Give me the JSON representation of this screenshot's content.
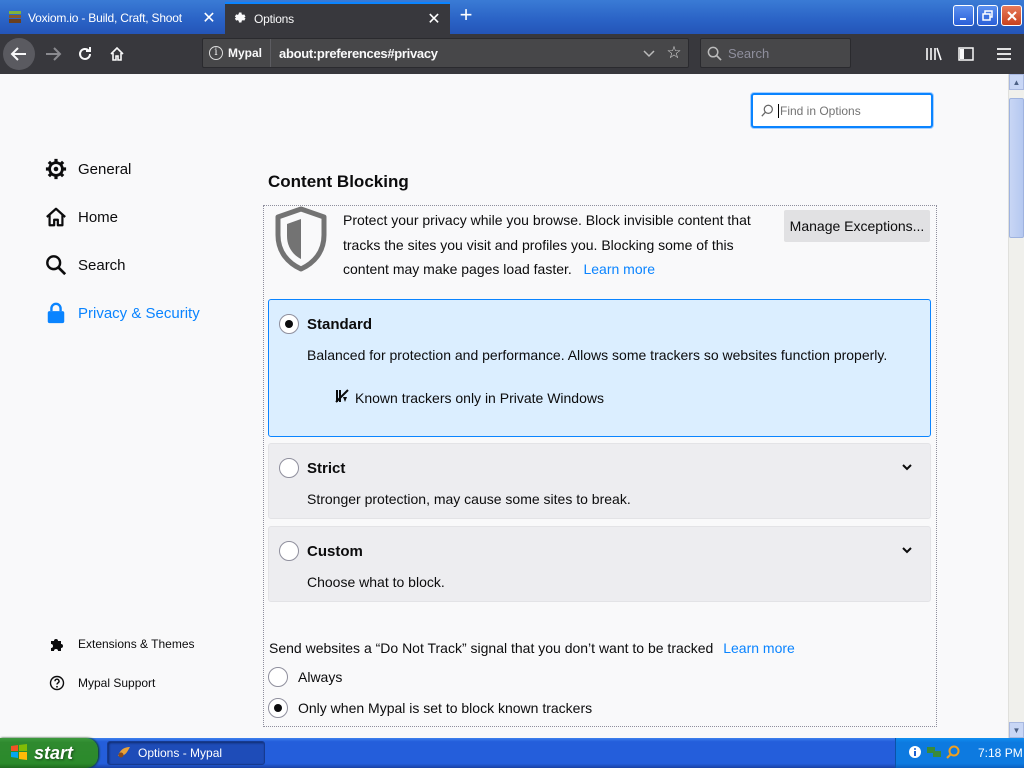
{
  "browser": {
    "tabs": [
      {
        "title": "Voxiom.io - Build, Craft, Shoot",
        "active": false
      },
      {
        "title": "Options",
        "active": true
      }
    ],
    "identity_label": "Mypal",
    "url": "about:preferences#privacy",
    "search_placeholder": "Search"
  },
  "prefs": {
    "find_placeholder": "Find in Options",
    "categories": [
      {
        "label": "General",
        "icon": "gear-icon"
      },
      {
        "label": "Home",
        "icon": "home-icon"
      },
      {
        "label": "Search",
        "icon": "search-icon"
      },
      {
        "label": "Privacy & Security",
        "icon": "lock-icon",
        "selected": true
      }
    ],
    "footer_links": [
      {
        "label": "Extensions & Themes",
        "icon": "puzzle-icon"
      },
      {
        "label": "Mypal Support",
        "icon": "help-icon"
      }
    ],
    "section_title": "Content Blocking",
    "description": "Protect your privacy while you browse. Block invisible content that tracks the sites you visit and profiles you. Blocking some of this content may make pages load faster.",
    "learn_more": "Learn more",
    "manage_exceptions": "Manage Exceptions...",
    "options": {
      "standard": {
        "title": "Standard",
        "desc": "Balanced for protection and performance. Allows some trackers so websites function properly.",
        "detail": "Known trackers only in Private Windows",
        "selected": true
      },
      "strict": {
        "title": "Strict",
        "desc": "Stronger protection, may cause some sites to break.",
        "selected": false
      },
      "custom": {
        "title": "Custom",
        "desc": "Choose what to block.",
        "selected": false
      }
    },
    "dnt": {
      "label": "Send websites a “Do Not Track” signal that you don’t want to be tracked",
      "learn_more": "Learn more",
      "always": "Always",
      "only_when": "Only when Mypal is set to block known trackers",
      "selected": "only_when"
    }
  },
  "taskbar": {
    "start_label": "start",
    "task_label": "Options - Mypal",
    "clock": "7:18 PM"
  },
  "colors": {
    "accent": "#0a84ff",
    "toolbar": "#38383d",
    "selected_option_bg": "#dbeeff"
  }
}
